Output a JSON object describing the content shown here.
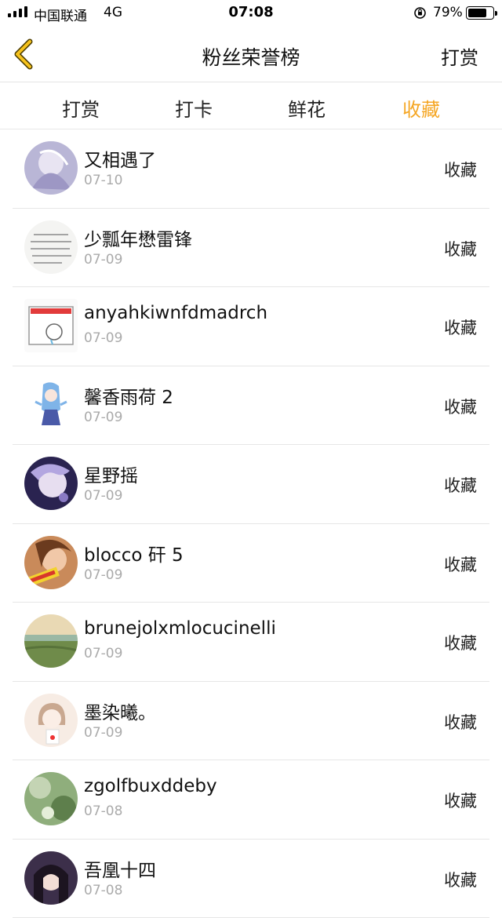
{
  "status_bar": {
    "carrier": "中国联通",
    "network": "4G",
    "time": "07:08",
    "battery_percent": "79%"
  },
  "nav": {
    "title": "粉丝荣誉榜",
    "action_label": "打赏"
  },
  "tabs": [
    {
      "label": "打赏",
      "active": false
    },
    {
      "label": "打卡",
      "active": false
    },
    {
      "label": "鲜花",
      "active": false
    },
    {
      "label": "收藏",
      "active": true
    }
  ],
  "accent_color": "#f5a623",
  "list": [
    {
      "name": "又相遇了",
      "date": "07-10",
      "action": "收藏"
    },
    {
      "name": "少瓢年懋雷锋",
      "date": "07-09",
      "action": "收藏"
    },
    {
      "name": "anyahkiwnfdmadrch",
      "date": "07-09",
      "action": "收藏"
    },
    {
      "name": "馨香雨荷 2",
      "date": "07-09",
      "action": "收藏"
    },
    {
      "name": "星野摇",
      "date": "07-09",
      "action": "收藏"
    },
    {
      "name": "blocco 矸 5",
      "date": "07-09",
      "action": "收藏"
    },
    {
      "name": "brunejolxmlocucinelli",
      "date": "07-09",
      "action": "收藏"
    },
    {
      "name": "墨染曦。",
      "date": "07-09",
      "action": "收藏"
    },
    {
      "name": "zgolfbuxddeby",
      "date": "07-08",
      "action": "收藏"
    },
    {
      "name": "吾凰十四",
      "date": "07-08",
      "action": "收藏"
    }
  ]
}
